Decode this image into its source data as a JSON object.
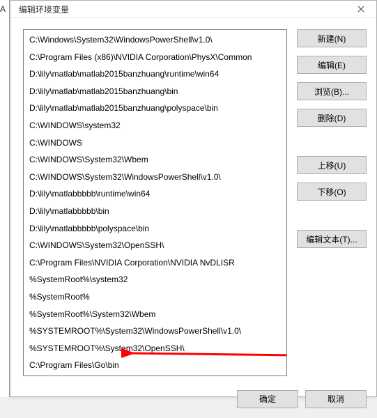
{
  "window": {
    "title": "编辑环境变量"
  },
  "list": {
    "items": [
      "C:\\Windows\\System32\\WindowsPowerShell\\v1.0\\",
      "C:\\Program Files (x86)\\NVIDIA Corporation\\PhysX\\Common",
      "D:\\lily\\matlab\\matlab2015banzhuang\\runtime\\win64",
      "D:\\lily\\matlab\\matlab2015banzhuang\\bin",
      "D:\\lily\\matlab\\matlab2015banzhuang\\polyspace\\bin",
      "C:\\WINDOWS\\system32",
      "C:\\WINDOWS",
      "C:\\WINDOWS\\System32\\Wbem",
      "C:\\WINDOWS\\System32\\WindowsPowerShell\\v1.0\\",
      "D:\\lily\\matlabbbbb\\runtime\\win64",
      "D:\\lily\\matlabbbbb\\bin",
      "D:\\lily\\matlabbbbb\\polyspace\\bin",
      "C:\\WINDOWS\\System32\\OpenSSH\\",
      "C:\\Program Files\\NVIDIA Corporation\\NVIDIA NvDLISR",
      "%SystemRoot%\\system32",
      "%SystemRoot%",
      "%SystemRoot%\\System32\\Wbem",
      "%SYSTEMROOT%\\System32\\WindowsPowerShell\\v1.0\\",
      "%SYSTEMROOT%\\System32\\OpenSSH\\",
      "C:\\Program Files\\Go\\bin"
    ]
  },
  "buttons": {
    "new": "新建(N)",
    "edit": "编辑(E)",
    "browse": "浏览(B)...",
    "delete": "删除(D)",
    "moveUp": "上移(U)",
    "moveDown": "下移(O)",
    "editText": "编辑文本(T)...",
    "ok": "确定",
    "cancel": "取消"
  },
  "annotation": {
    "arrow_color": "#ff0000"
  },
  "bg": {
    "char": "A"
  }
}
